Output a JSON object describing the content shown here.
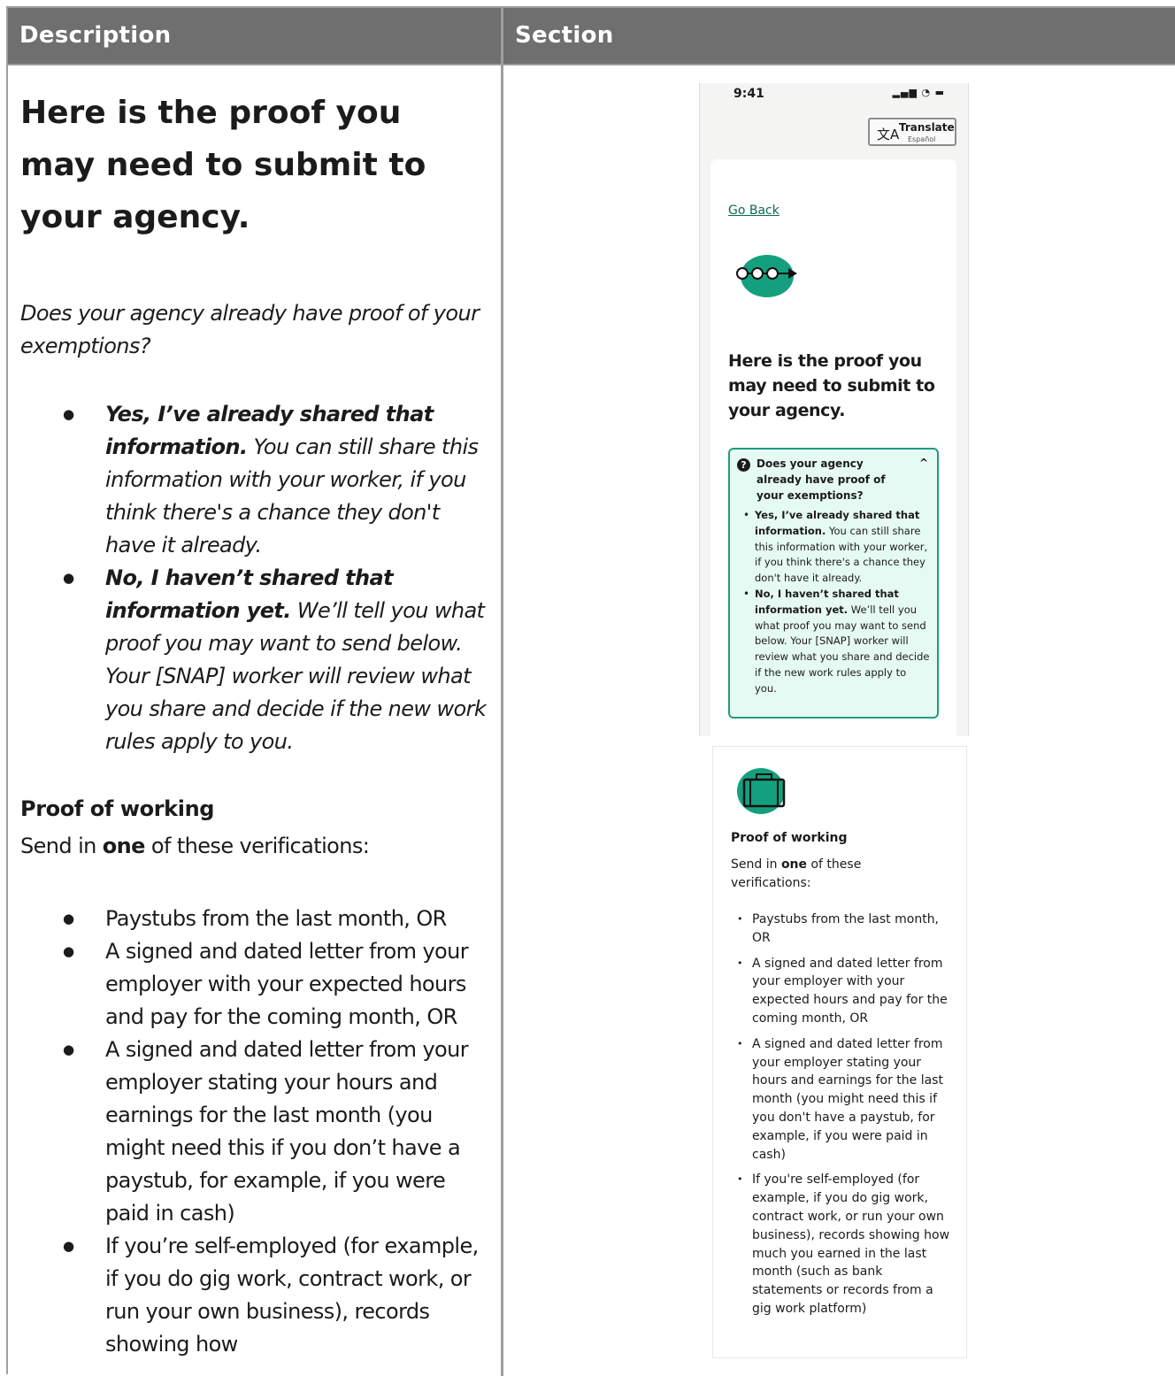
{
  "header": {
    "col_left": "Description",
    "col_right": "Section"
  },
  "left": {
    "title": "Here is the proof you may need to submit to your agency.",
    "question": "Does your agency already have proof of your exemptions?",
    "answers": [
      {
        "bold": "Yes, I’ve already shared that information.",
        "rest": " You can still share this information with your worker, if you think there's a chance they don't have it already."
      },
      {
        "bold": "No, I haven’t shared that information yet.",
        "rest": " We’ll tell you what proof you may want to send below. Your [SNAP] worker will review what you share and decide if the new work rules apply to you."
      }
    ],
    "section_title": "Proof of working",
    "send_pre": "Send in ",
    "send_bold": "one",
    "send_post": " of these verifications:",
    "items": [
      "Paystubs from the last month, OR",
      "A signed and dated letter from your employer with your expected hours and pay for the coming month, OR",
      "A signed and dated letter from your employer stating your hours and earnings for the last month (you might need this if you don’t have a paystub, for example, if you were paid in cash)",
      "If you’re self-employed (for example, if you do gig work, contract work, or run your own business), records showing how"
    ]
  },
  "phone": {
    "time": "9:41",
    "translate_label": "Translate",
    "translate_sub": "Español",
    "go_back": "Go Back",
    "title": "Here is the proof you may need to submit to your agency.",
    "accordion_title": "Does your agency already have proof of your exemptions?",
    "accordion_items": [
      {
        "bold": "Yes, I’ve already shared that information.",
        "rest": " You can still share this information with your worker, if you think there's a chance they don't have it already."
      },
      {
        "bold": "No, I haven’t shared that information yet.",
        "rest": " We’ll tell you what proof you may want to send below. Your [SNAP] worker will review what you share and decide if the new work rules apply to you."
      }
    ],
    "section_title": "Proof of working",
    "send_pre": "Send in ",
    "send_bold": "one",
    "send_post": " of these verifications:",
    "items": [
      "Paystubs from the last month, OR",
      "A signed and dated letter from your employer with your expected hours and pay for the coming month, OR",
      "A signed and dated letter from your employer stating your hours and earnings for the last month (you might need this if you don't have a paystub, for example, if you were paid in cash)",
      "If you're self-employed (for example, if you do gig work, contract work, or run your own business), records showing how much you earned in the last month (such as bank statements or records from a gig work platform)"
    ]
  },
  "icons": {
    "signal": "signal-icon",
    "wifi": "wifi-icon",
    "battery": "battery-icon",
    "translate": "translate-icon",
    "chevron": "chevron-up-icon",
    "question": "question-icon",
    "progress": "progress-steps-icon",
    "briefcase": "briefcase-icon"
  },
  "colors": {
    "header_bg": "#6f6f6f",
    "accent": "#1e9e7c",
    "accordion_bg": "#e6faf4",
    "link": "#0b6a52"
  }
}
